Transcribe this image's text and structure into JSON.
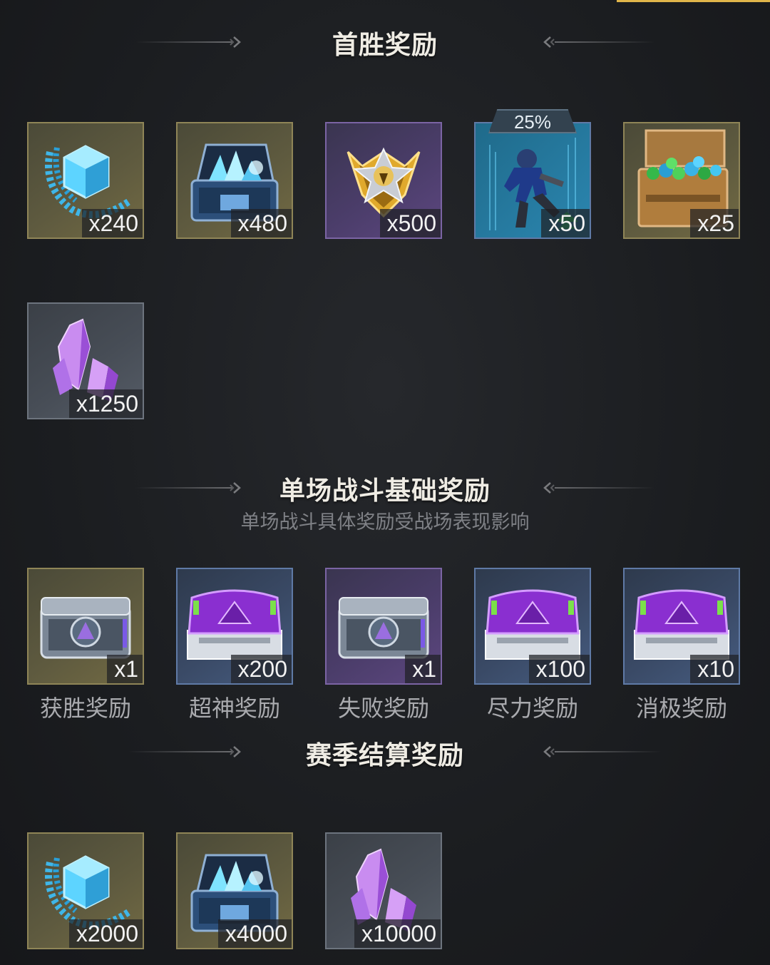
{
  "sections": {
    "first_win": {
      "title": "首胜奖励",
      "rewards": [
        {
          "item": "blue-crystal-emblem",
          "quantity": "x240",
          "rarity": "gold"
        },
        {
          "item": "crystal-chest",
          "quantity": "x480",
          "rarity": "gold"
        },
        {
          "item": "gold-rank-badge",
          "quantity": "x500",
          "rarity": "purple"
        },
        {
          "item": "soldier-card",
          "quantity": "x50",
          "rarity": "blue",
          "badge": "25%"
        },
        {
          "item": "gem-crate",
          "quantity": "x25",
          "rarity": "gold"
        },
        {
          "item": "purple-crystal",
          "quantity": "x1250",
          "rarity": "grey"
        }
      ]
    },
    "single_battle": {
      "title": "单场战斗基础奖励",
      "subtitle": "单场战斗具体奖励受战场表现影响",
      "rewards": [
        {
          "item": "silver-chest",
          "quantity": "x1",
          "label": "获胜奖励",
          "rarity": "gold"
        },
        {
          "item": "purple-chest",
          "quantity": "x200",
          "label": "超神奖励",
          "rarity": "blue"
        },
        {
          "item": "silver-chest",
          "quantity": "x1",
          "label": "失败奖励",
          "rarity": "purple"
        },
        {
          "item": "purple-chest",
          "quantity": "x100",
          "label": "尽力奖励",
          "rarity": "blue"
        },
        {
          "item": "purple-chest",
          "quantity": "x10",
          "label": "消极奖励",
          "rarity": "blue"
        }
      ]
    },
    "season_end": {
      "title": "赛季结算奖励",
      "rewards": [
        {
          "item": "blue-crystal-emblem",
          "quantity": "x2000",
          "rarity": "gold"
        },
        {
          "item": "crystal-chest",
          "quantity": "x4000",
          "rarity": "gold"
        },
        {
          "item": "purple-crystal",
          "quantity": "x10000",
          "rarity": "grey"
        }
      ]
    }
  },
  "colors": {
    "accent_gold": "#e0b54a",
    "tile_gold": "#8f8557",
    "tile_purple": "#7b64a4",
    "tile_blue": "#5f7aa6",
    "tile_grey": "#6d747e"
  }
}
